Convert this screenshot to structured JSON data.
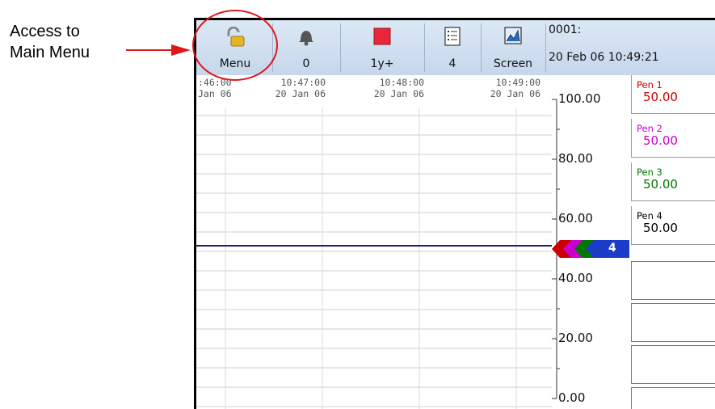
{
  "callout": {
    "line1": "Access to",
    "line2": "Main Menu"
  },
  "toolbar": {
    "menu_label": "Menu",
    "alarm_label": "0",
    "group_label": "1y+",
    "list_label": "4",
    "screen_label": "Screen",
    "device_id": "0001:",
    "datetime": "20 Feb 06 10:49:21"
  },
  "time_axis": [
    {
      "time": ":46:00",
      "date": "Jan 06"
    },
    {
      "time": "10:47:00",
      "date": "20 Jan 06"
    },
    {
      "time": "10:48:00",
      "date": "20 Jan 06"
    },
    {
      "time": "10:49:00",
      "date": "20 Jan 06"
    }
  ],
  "scale_labels": [
    "100.00",
    "80.00",
    "60.00",
    "40.00",
    "20.00",
    "0.00"
  ],
  "pens": [
    {
      "name": "Pen 1",
      "value": "50.00",
      "color": "#cc0000"
    },
    {
      "name": "Pen 2",
      "value": "50.00",
      "color": "#cc00cc"
    },
    {
      "name": "Pen 3",
      "value": "50.00",
      "color": "#007700"
    },
    {
      "name": "Pen 4",
      "value": "50.00",
      "color": "#000000"
    }
  ],
  "pen_marker_label": "4",
  "colors": {
    "callout_red": "#e0161b",
    "trace_navy": "#1c1c7a",
    "toolbar_top": "#dce8f5",
    "toolbar_bottom": "#c6d7eb"
  },
  "icons": [
    "padlock-icon",
    "bell-icon",
    "red-square-icon",
    "list-icon",
    "screen-icon",
    "right-arrow-icon"
  ]
}
